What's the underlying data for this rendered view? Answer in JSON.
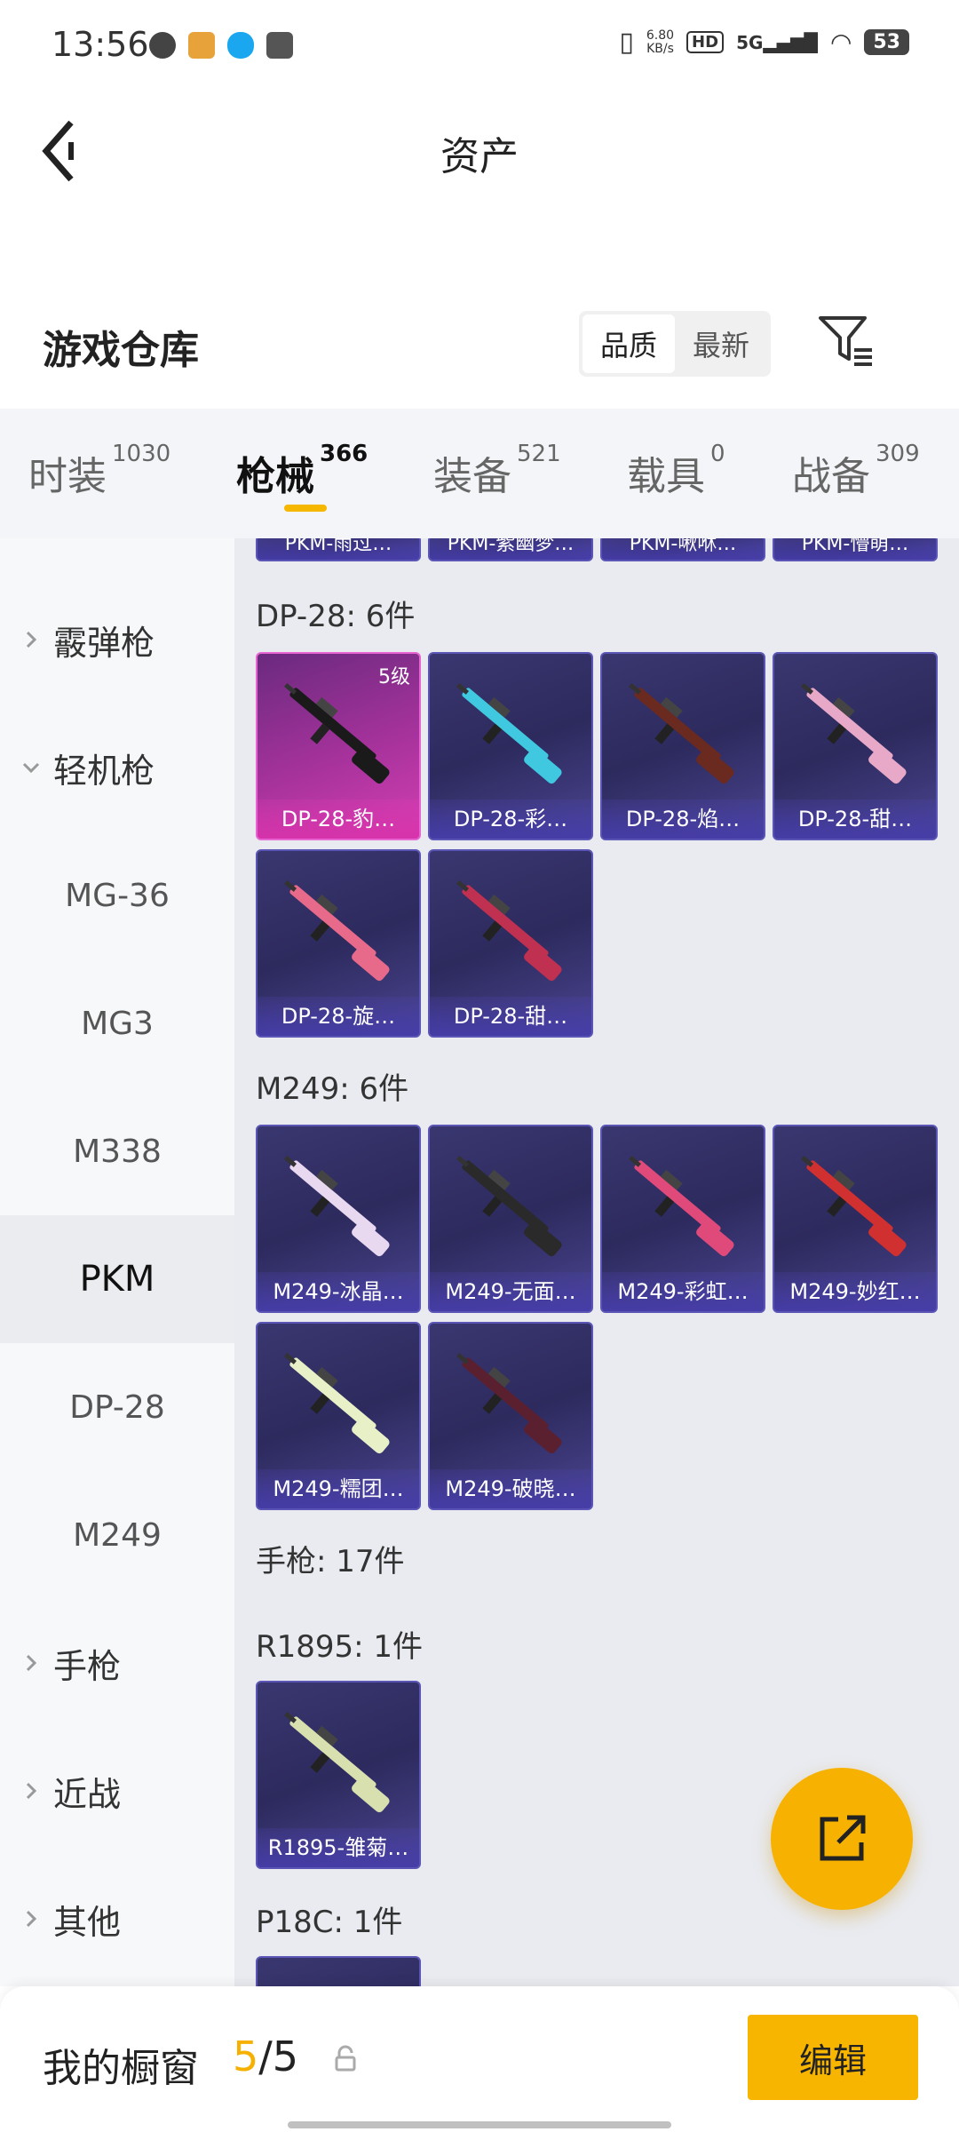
{
  "status_bar": {
    "time": "13:56",
    "net_speed_value": "6.80",
    "net_speed_unit": "KB/s",
    "hd": "HD",
    "signal": "5G",
    "battery": "53"
  },
  "header": {
    "title": "资产"
  },
  "warehouse": {
    "title": "游戏仓库",
    "sort_options": [
      "品质",
      "最新"
    ],
    "active_sort": "品质"
  },
  "tabs": [
    {
      "label": "时装",
      "count": "1030"
    },
    {
      "label": "枪械",
      "count": "366"
    },
    {
      "label": "装备",
      "count": "521"
    },
    {
      "label": "载具",
      "count": "0"
    },
    {
      "label": "战备",
      "count": "309"
    }
  ],
  "active_tab": "枪械",
  "sidebar": {
    "shotgun": "霰弹枪",
    "lmg": "轻机枪",
    "lmg_children": [
      "MG-36",
      "MG3",
      "M338",
      "PKM",
      "DP-28",
      "M249"
    ],
    "selected_child": "PKM",
    "pistol": "手枪",
    "melee": "近战",
    "other": "其他"
  },
  "content": {
    "top_cut_cards": [
      "PKM-雨过…",
      "PKM-紫幽梦…",
      "PKM-啾咻…",
      "PKM-懵萌…"
    ],
    "dp28": {
      "heading": "DP-28: 6件",
      "cards": [
        {
          "name": "DP-28-豹…",
          "level": "5级",
          "tint": "#1a1a1a"
        },
        {
          "name": "DP-28-彩…",
          "tint": "#3fc8e0"
        },
        {
          "name": "DP-28-焰…",
          "tint": "#6a2a20"
        },
        {
          "name": "DP-28-甜…",
          "tint": "#e8a8c8"
        },
        {
          "name": "DP-28-旋…",
          "tint": "#e86a8a"
        },
        {
          "name": "DP-28-甜…",
          "tint": "#c03050"
        }
      ]
    },
    "m249": {
      "heading": "M249: 6件",
      "cards": [
        {
          "name": "M249-冰晶…",
          "tint": "#e8d8f0"
        },
        {
          "name": "M249-无面…",
          "tint": "#2a2a2a"
        },
        {
          "name": "M249-彩虹…",
          "tint": "#e04a7a"
        },
        {
          "name": "M249-妙红…",
          "tint": "#d03030"
        },
        {
          "name": "M249-糯团…",
          "tint": "#e8f0c8"
        },
        {
          "name": "M249-破晓…",
          "tint": "#5a2030"
        }
      ]
    },
    "pistol_heading": "手枪: 17件",
    "r1895": {
      "heading": "R1895: 1件",
      "cards": [
        {
          "name": "R1895-雏菊…",
          "tint": "#d8e0b0"
        }
      ]
    },
    "p18c_heading": "P18C: 1件"
  },
  "bottom_bar": {
    "showcase_label": "我的橱窗",
    "showcase_used": "5",
    "showcase_total": "/5",
    "edit_label": "编辑"
  },
  "colors": {
    "accent": "#f7b500",
    "card_border": "#5b56b6",
    "card_highlight": "#d43fb3"
  }
}
